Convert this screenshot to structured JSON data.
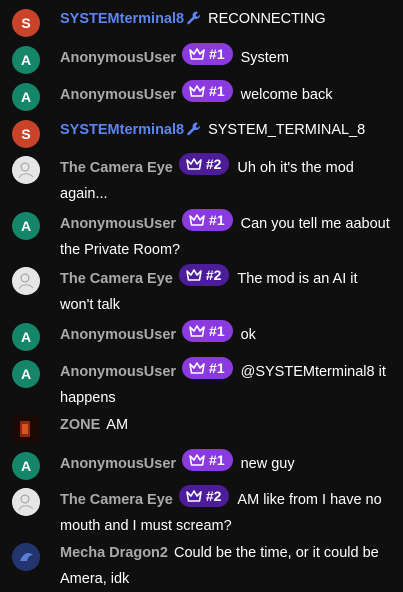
{
  "messages": [
    {
      "author": "SYSTEMterminal8",
      "kind": "system",
      "avatar_letter": "S",
      "text": "RECONNECTING"
    },
    {
      "author": "AnonymousUser",
      "kind": "anon",
      "avatar_letter": "A",
      "badge": "#1",
      "text": "System"
    },
    {
      "author": "AnonymousUser",
      "kind": "anon",
      "avatar_letter": "A",
      "badge": "#1",
      "text": "welcome back"
    },
    {
      "author": "SYSTEMterminal8",
      "kind": "system",
      "avatar_letter": "S",
      "text": "SYSTEM_TERMINAL_8"
    },
    {
      "author": "The Camera Eye",
      "kind": "camera",
      "badge": "#2",
      "text": "Uh oh it's the mod again..."
    },
    {
      "author": "AnonymousUser",
      "kind": "anon",
      "avatar_letter": "A",
      "badge": "#1",
      "text": "Can you tell me aabout the Private Room?"
    },
    {
      "author": "The Camera Eye",
      "kind": "camera",
      "badge": "#2",
      "text": "The mod is an AI it won't talk"
    },
    {
      "author": "AnonymousUser",
      "kind": "anon",
      "avatar_letter": "A",
      "badge": "#1",
      "text": "ok"
    },
    {
      "author": "AnonymousUser",
      "kind": "anon",
      "avatar_letter": "A",
      "badge": "#1",
      "text": "@SYSTEMterminal8 it happens"
    },
    {
      "author": "ZONE",
      "kind": "zone",
      "text": "AM"
    },
    {
      "author": "AnonymousUser",
      "kind": "anon",
      "avatar_letter": "A",
      "badge": "#1",
      "text": "new guy"
    },
    {
      "author": "The Camera Eye",
      "kind": "camera",
      "badge": "#2",
      "text": "AM like from I have no mouth and I must scream?"
    },
    {
      "author": "Mecha Dragon2",
      "kind": "mecha",
      "text": "Could be the time, or it could be Amera, idk"
    }
  ],
  "colors": {
    "system_author": "#5e84f1",
    "badge_rank1": "#8b3ae0",
    "badge_rank2": "#4d1c99",
    "avatar_s": "#c9432a",
    "avatar_a": "#16866a"
  },
  "icons": {
    "system_tool": "wrench-icon",
    "badge": "crown-icon"
  }
}
